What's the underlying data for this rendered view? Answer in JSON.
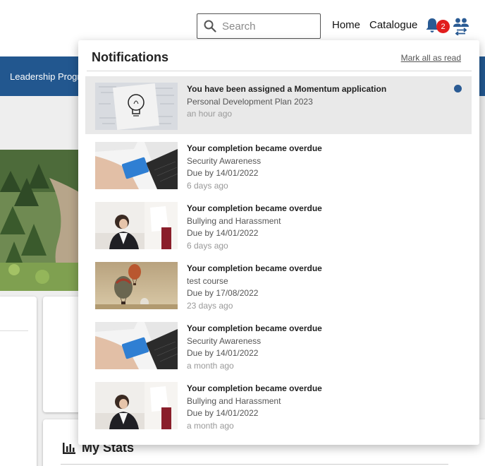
{
  "header": {
    "search_placeholder": "Search",
    "nav": [
      "Home",
      "Catalogue"
    ],
    "notification_count": "2"
  },
  "background": {
    "band_text": "Leadership Progra",
    "stats_title": "My Stats"
  },
  "notifications": {
    "title": "Notifications",
    "mark_all": "Mark all as read",
    "items": [
      {
        "title": "You have been assigned a Momentum application",
        "course": "Personal Development Plan 2023",
        "due": "",
        "time": "an hour ago",
        "unread": true,
        "image": "lightbulb-sketch"
      },
      {
        "title": "Your completion became overdue",
        "course": "Security Awareness",
        "due": "Due by 14/01/2022",
        "time": "6 days ago",
        "unread": false,
        "image": "credit-card-laptop"
      },
      {
        "title": "Your completion became overdue",
        "course": "Bullying and Harassment",
        "due": "Due by 14/01/2022",
        "time": "6 days ago",
        "unread": false,
        "image": "stressed-office-worker"
      },
      {
        "title": "Your completion became overdue",
        "course": "test course",
        "due": "Due by 17/08/2022",
        "time": "23 days ago",
        "unread": false,
        "image": "hot-air-balloons"
      },
      {
        "title": "Your completion became overdue",
        "course": "Security Awareness",
        "due": "Due by 14/01/2022",
        "time": "a month ago",
        "unread": false,
        "image": "credit-card-laptop"
      },
      {
        "title": "Your completion became overdue",
        "course": "Bullying and Harassment",
        "due": "Due by 14/01/2022",
        "time": "a month ago",
        "unread": false,
        "image": "stressed-office-worker"
      }
    ]
  },
  "colors": {
    "accent_blue": "#22578f",
    "badge_red": "#e11d1d",
    "unread_dot": "#2a5b94"
  }
}
